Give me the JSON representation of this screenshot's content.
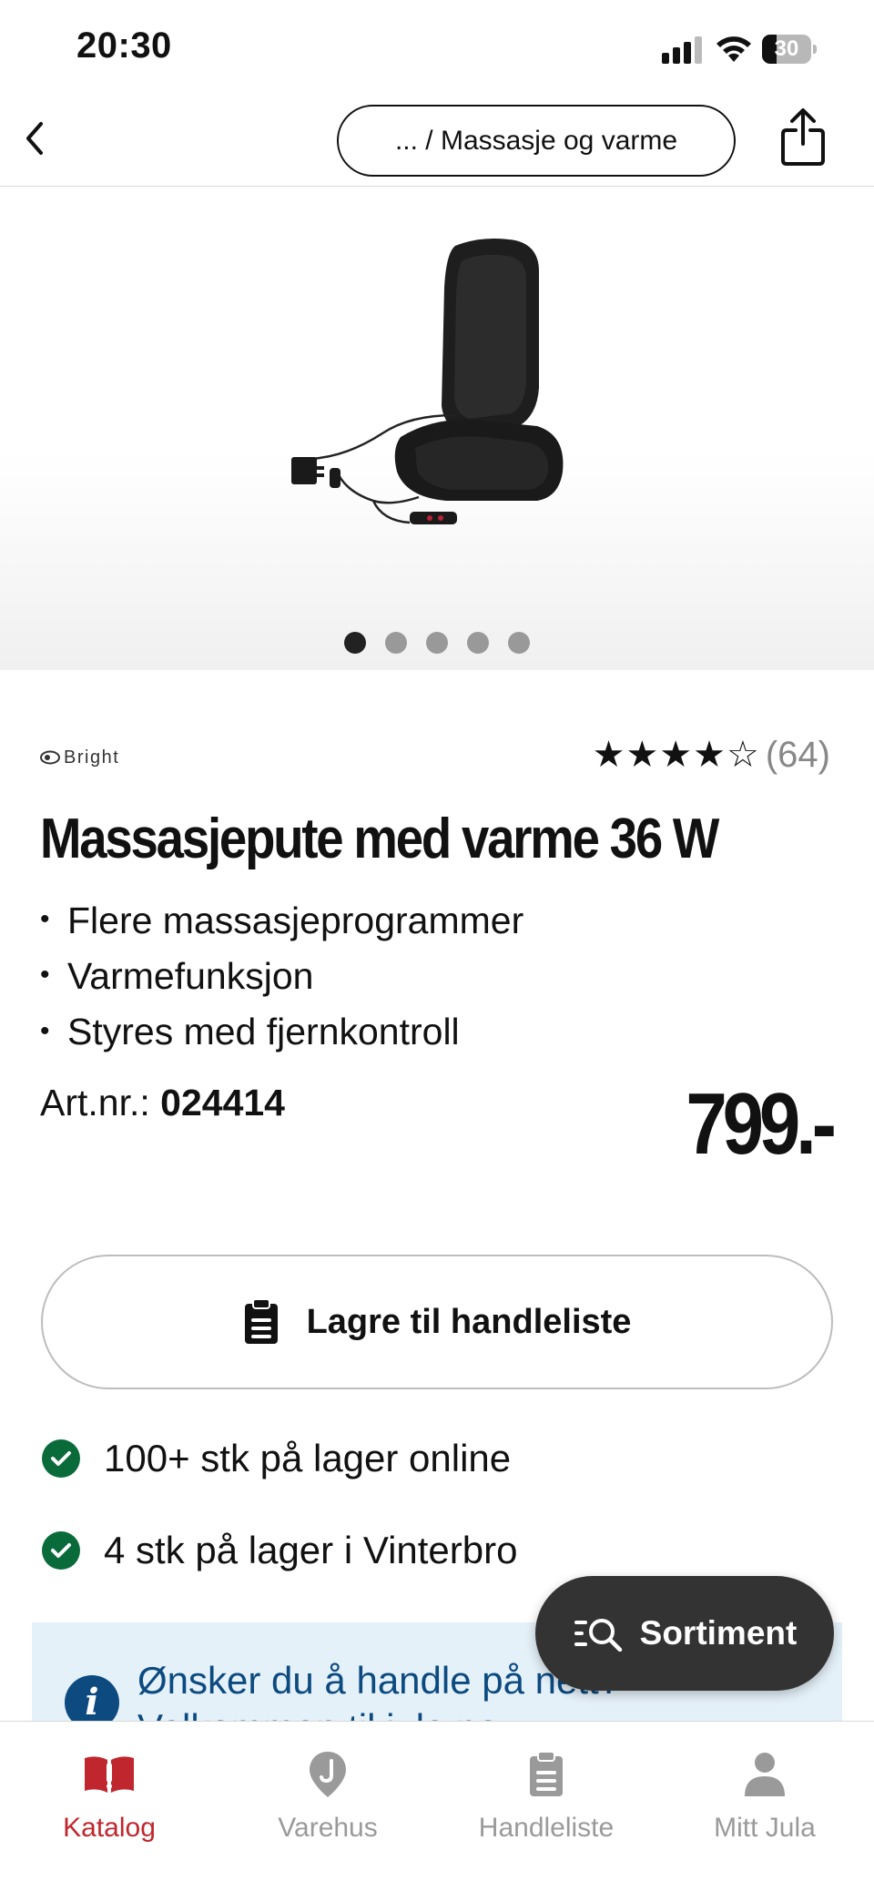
{
  "status_bar": {
    "time": "20:30",
    "battery_level": "30",
    "battery_fraction": 0.3
  },
  "nav": {
    "breadcrumb": "... / Massasje og varme"
  },
  "gallery": {
    "image_count": 5,
    "active_index": 0
  },
  "product": {
    "brand": "Bright",
    "rating": 4.5,
    "rating_stars": "★★★★☆",
    "review_count": "(64)",
    "title": "Massasjepute med varme 36 W",
    "bullets": [
      "Flere massasjeprogrammer",
      "Varmefunksjon",
      "Styres med fjernkontroll"
    ],
    "artnr_label": "Art.nr.:",
    "artnr_value": "024414",
    "price": "799.-"
  },
  "actions": {
    "save_label": "Lagre til handleliste"
  },
  "stock": [
    {
      "text": "100+ stk på lager online"
    },
    {
      "text": "4 stk på lager i Vinterbro"
    }
  ],
  "info_banner": {
    "line1": "Ønsker du å handle på nett?",
    "line2": "Velkommen til jula.no"
  },
  "fab": {
    "label": "Sortiment"
  },
  "tabs": [
    {
      "label": "Katalog",
      "icon": "book-icon",
      "active": true
    },
    {
      "label": "Varehus",
      "icon": "map-pin-icon",
      "active": false
    },
    {
      "label": "Handleliste",
      "icon": "clipboard-icon",
      "active": false
    },
    {
      "label": "Mitt Jula",
      "icon": "person-icon",
      "active": false
    }
  ],
  "colors": {
    "accent": "#c0262d",
    "stock_green": "#0a6b3a",
    "info_blue": "#0c4a80",
    "fab_bg": "#333333"
  }
}
